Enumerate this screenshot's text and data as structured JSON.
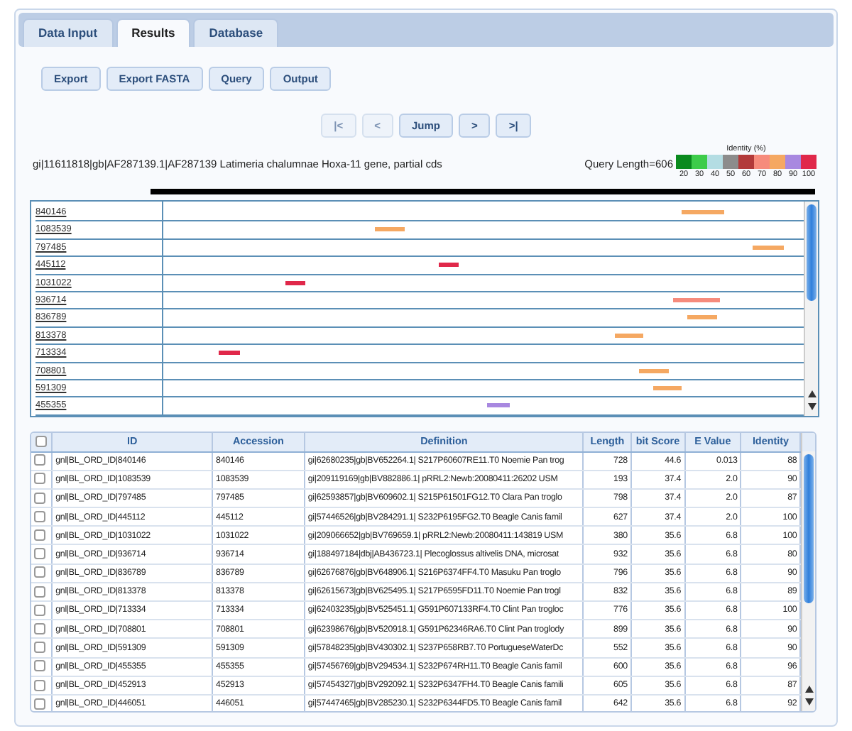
{
  "tabs": [
    {
      "label": "Data Input",
      "selected": false
    },
    {
      "label": "Results",
      "selected": true
    },
    {
      "label": "Database",
      "selected": false
    }
  ],
  "toolbar": [
    "Export",
    "Export FASTA",
    "Query",
    "Output"
  ],
  "pager": [
    {
      "label": "|<",
      "disabled": true
    },
    {
      "label": "<",
      "disabled": true
    },
    {
      "label": "Jump",
      "disabled": false
    },
    {
      "label": ">",
      "disabled": false
    },
    {
      "label": ">|",
      "disabled": false
    }
  ],
  "query": {
    "title": "gi|11611818|gb|AF287139.1|AF287139 Latimeria chalumnae Hoxa-11 gene, partial cds",
    "length": "Query Length=606"
  },
  "identity_legend": {
    "title": "Identity (%)",
    "items": [
      {
        "label": "20",
        "color": "#0a8a1e"
      },
      {
        "label": "30",
        "color": "#3dcc4a"
      },
      {
        "label": "40",
        "color": "#b4dde3"
      },
      {
        "label": "50",
        "color": "#8c8c8c"
      },
      {
        "label": "60",
        "color": "#b23a3a"
      },
      {
        "label": "70",
        "color": "#f68b7c"
      },
      {
        "label": "80",
        "color": "#f5a862"
      },
      {
        "label": "90",
        "color": "#a888e0"
      },
      {
        "label": "100",
        "color": "#e0284a"
      }
    ]
  },
  "hits": [
    {
      "label": "840146",
      "color": "#f5a862"
    },
    {
      "label": "1083539",
      "color": "#f5a862"
    },
    {
      "label": "797485",
      "color": "#f5a862"
    },
    {
      "label": "445112",
      "color": "#e0284a"
    },
    {
      "label": "1031022",
      "color": "#e0284a"
    },
    {
      "label": "936714",
      "color": "#f68b7c"
    },
    {
      "label": "836789",
      "color": "#f5a862"
    },
    {
      "label": "813378",
      "color": "#f5a862"
    },
    {
      "label": "713334",
      "color": "#e0284a"
    },
    {
      "label": "708801",
      "color": "#f5a862"
    },
    {
      "label": "591309",
      "color": "#f5a862"
    },
    {
      "label": "455355",
      "color": "#a888e0"
    }
  ],
  "table": {
    "select_all_checked": false,
    "columns": [
      "ID",
      "Accession",
      "Definition",
      "Length",
      "bit Score",
      "E Value",
      "Identity"
    ],
    "rows": [
      {
        "checked": false,
        "cells": [
          "gnl|BL_ORD_ID|840146",
          "840146",
          "gi|62680235|gb|BV652264.1| S217P60607RE11.T0 Noemie Pan trog",
          "728",
          "44.6",
          "0.013",
          "88"
        ]
      },
      {
        "checked": false,
        "cells": [
          "gnl|BL_ORD_ID|1083539",
          "1083539",
          "gi|209119169|gb|BV882886.1| pRRL2:Newb:20080411:26202 USM",
          "193",
          "37.4",
          "2.0",
          "90"
        ]
      },
      {
        "checked": false,
        "cells": [
          "gnl|BL_ORD_ID|797485",
          "797485",
          "gi|62593857|gb|BV609602.1| S215P61501FG12.T0 Clara Pan troglo",
          "798",
          "37.4",
          "2.0",
          "87"
        ]
      },
      {
        "checked": false,
        "cells": [
          "gnl|BL_ORD_ID|445112",
          "445112",
          "gi|57446526|gb|BV284291.1| S232P6195FG2.T0 Beagle Canis famil",
          "627",
          "37.4",
          "2.0",
          "100"
        ]
      },
      {
        "checked": false,
        "cells": [
          "gnl|BL_ORD_ID|1031022",
          "1031022",
          "gi|209066652|gb|BV769659.1| pRRL2:Newb:20080411:143819 USM",
          "380",
          "35.6",
          "6.8",
          "100"
        ]
      },
      {
        "checked": false,
        "cells": [
          "gnl|BL_ORD_ID|936714",
          "936714",
          "gi|188497184|dbj|AB436723.1| Plecoglossus altivelis DNA, microsat",
          "932",
          "35.6",
          "6.8",
          "80"
        ]
      },
      {
        "checked": false,
        "cells": [
          "gnl|BL_ORD_ID|836789",
          "836789",
          "gi|62676876|gb|BV648906.1| S216P6374FF4.T0 Masuku Pan troglo",
          "796",
          "35.6",
          "6.8",
          "90"
        ]
      },
      {
        "checked": false,
        "cells": [
          "gnl|BL_ORD_ID|813378",
          "813378",
          "gi|62615673|gb|BV625495.1| S217P6595FD11.T0 Noemie Pan trogl",
          "832",
          "35.6",
          "6.8",
          "89"
        ]
      },
      {
        "checked": false,
        "cells": [
          "gnl|BL_ORD_ID|713334",
          "713334",
          "gi|62403235|gb|BV525451.1| G591P607133RF4.T0 Clint Pan trogloc",
          "776",
          "35.6",
          "6.8",
          "100"
        ]
      },
      {
        "checked": false,
        "cells": [
          "gnl|BL_ORD_ID|708801",
          "708801",
          "gi|62398676|gb|BV520918.1| G591P62346RA6.T0 Clint Pan troglody",
          "899",
          "35.6",
          "6.8",
          "90"
        ]
      },
      {
        "checked": false,
        "cells": [
          "gnl|BL_ORD_ID|591309",
          "591309",
          "gi|57848235|gb|BV430302.1| S237P658RB7.T0 PortugueseWaterDc",
          "552",
          "35.6",
          "6.8",
          "90"
        ]
      },
      {
        "checked": false,
        "cells": [
          "gnl|BL_ORD_ID|455355",
          "455355",
          "gi|57456769|gb|BV294534.1| S232P674RH11.T0 Beagle Canis famil",
          "600",
          "35.6",
          "6.8",
          "96"
        ]
      },
      {
        "checked": false,
        "cells": [
          "gnl|BL_ORD_ID|452913",
          "452913",
          "gi|57454327|gb|BV292092.1| S232P6347FH4.T0 Beagle Canis famili",
          "605",
          "35.6",
          "6.8",
          "87"
        ]
      },
      {
        "checked": false,
        "cells": [
          "gnl|BL_ORD_ID|446051",
          "446051",
          "gi|57447465|gb|BV285230.1| S232P6344FD5.T0 Beagle Canis famil",
          "642",
          "35.6",
          "6.8",
          "92"
        ]
      }
    ]
  }
}
